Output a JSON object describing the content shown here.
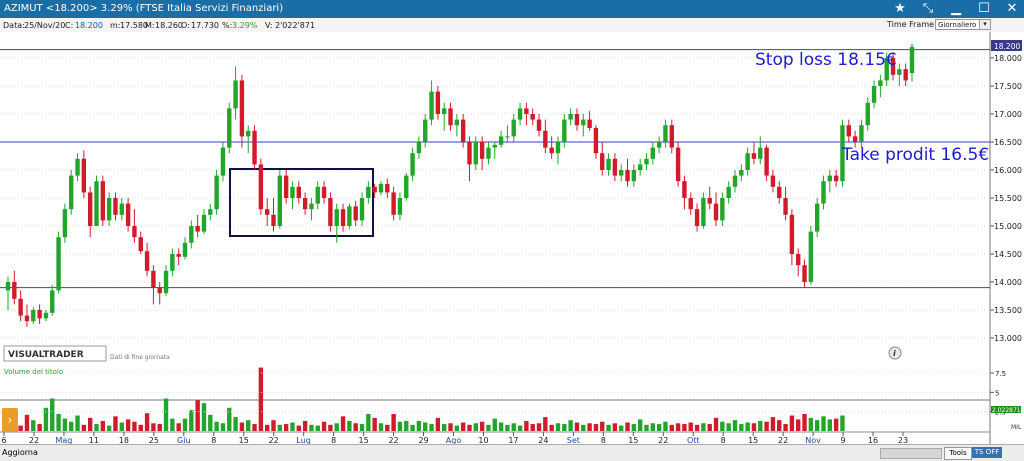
{
  "window": {
    "title": "AZIMUT <18.200> 3.29%  (FTSE Italia Servizi Finanziari)",
    "controls": [
      "star-icon",
      "fullscreen-icon",
      "minimize-icon",
      "maximize-icon",
      "close-icon"
    ]
  },
  "info": {
    "data_label": "Data:",
    "data_value": "25/Nov/20",
    "c_label": "C:",
    "c_value": "18.200",
    "m_label": "m:",
    "m_value": "17.580",
    "M_label": "M:",
    "M_value": "18.260",
    "o_label": "O:",
    "o_value": "17.730",
    "pct_label": "%:",
    "pct_value": "3.29%",
    "v_label": "V:",
    "v_value": "2'022'871",
    "timeframe_label": "Time Frame",
    "timeframe_value": "Giornaliero"
  },
  "chart": {
    "price_axis": [
      "18.000",
      "17.500",
      "17.000",
      "16.500",
      "16.000",
      "15.500",
      "15.000",
      "14.500",
      "14.000",
      "13.500",
      "13.000"
    ],
    "last_price_badge": "18.200",
    "annotations": {
      "stop_loss": "Stop loss 18.15€",
      "take_profit": "Take prodit 16.5€"
    },
    "brand": "VISUALTRADER",
    "brand_sub": "Dati di fine giornata",
    "volume_label": "Volume del titolo",
    "volume_axis": [
      "7.5",
      "5",
      "2.5"
    ],
    "volume_unit": "MIL",
    "volume_last": "2.022871",
    "x_axis": [
      {
        "t": "6",
        "month": false
      },
      {
        "t": "22",
        "month": false
      },
      {
        "t": "Mag",
        "month": true
      },
      {
        "t": "11",
        "month": false
      },
      {
        "t": "18",
        "month": false
      },
      {
        "t": "25",
        "month": false
      },
      {
        "t": "Giu",
        "month": true
      },
      {
        "t": "8",
        "month": false
      },
      {
        "t": "15",
        "month": false
      },
      {
        "t": "22",
        "month": false
      },
      {
        "t": "Lug",
        "month": true
      },
      {
        "t": "8",
        "month": false
      },
      {
        "t": "15",
        "month": false
      },
      {
        "t": "22",
        "month": false
      },
      {
        "t": "29",
        "month": false
      },
      {
        "t": "Ago",
        "month": true
      },
      {
        "t": "10",
        "month": false
      },
      {
        "t": "17",
        "month": false
      },
      {
        "t": "24",
        "month": false
      },
      {
        "t": "Set",
        "month": true
      },
      {
        "t": "8",
        "month": false
      },
      {
        "t": "15",
        "month": false
      },
      {
        "t": "22",
        "month": false
      },
      {
        "t": "Ott",
        "month": true
      },
      {
        "t": "8",
        "month": false
      },
      {
        "t": "15",
        "month": false
      },
      {
        "t": "22",
        "month": false
      },
      {
        "t": "Nov",
        "month": true
      },
      {
        "t": "9",
        "month": false
      },
      {
        "t": "16",
        "month": false
      },
      {
        "t": "23",
        "month": false
      }
    ],
    "info_icon": "info-icon",
    "colors": {
      "up": "#22a52b",
      "down": "#d11a2a",
      "hline": "#3a3ad6",
      "annotation": "#1c1ccf",
      "box": "#111144"
    }
  },
  "bottom": {
    "aggiorna": "Aggiorna",
    "tools": "Tools",
    "ts_off": "TS OFF"
  },
  "chart_data": {
    "type": "candlestick",
    "ylim": [
      12.9,
      18.4
    ],
    "hlines": [
      18.15,
      16.5,
      13.9
    ],
    "series": [
      {
        "o": 13.85,
        "h": 14.1,
        "l": 13.5,
        "c": 14.0
      },
      {
        "o": 14.0,
        "h": 14.2,
        "l": 13.6,
        "c": 13.7
      },
      {
        "o": 13.7,
        "h": 13.85,
        "l": 13.3,
        "c": 13.4
      },
      {
        "o": 13.4,
        "h": 13.6,
        "l": 13.2,
        "c": 13.3
      },
      {
        "o": 13.3,
        "h": 13.55,
        "l": 13.25,
        "c": 13.5
      },
      {
        "o": 13.5,
        "h": 13.6,
        "l": 13.25,
        "c": 13.35
      },
      {
        "o": 13.35,
        "h": 13.5,
        "l": 13.3,
        "c": 13.45
      },
      {
        "o": 13.45,
        "h": 13.95,
        "l": 13.4,
        "c": 13.85
      },
      {
        "o": 13.85,
        "h": 14.9,
        "l": 13.8,
        "c": 14.8
      },
      {
        "o": 14.8,
        "h": 15.4,
        "l": 14.7,
        "c": 15.3
      },
      {
        "o": 15.3,
        "h": 16.0,
        "l": 15.2,
        "c": 15.9
      },
      {
        "o": 15.9,
        "h": 16.3,
        "l": 15.8,
        "c": 16.2
      },
      {
        "o": 16.2,
        "h": 16.35,
        "l": 15.5,
        "c": 15.6
      },
      {
        "o": 15.6,
        "h": 15.7,
        "l": 14.8,
        "c": 15.0
      },
      {
        "o": 15.0,
        "h": 15.9,
        "l": 15.0,
        "c": 15.8
      },
      {
        "o": 15.8,
        "h": 15.9,
        "l": 15.0,
        "c": 15.1
      },
      {
        "o": 15.1,
        "h": 15.6,
        "l": 15.0,
        "c": 15.5
      },
      {
        "o": 15.5,
        "h": 15.6,
        "l": 15.1,
        "c": 15.2
      },
      {
        "o": 15.2,
        "h": 15.5,
        "l": 15.1,
        "c": 15.4
      },
      {
        "o": 15.4,
        "h": 15.5,
        "l": 14.9,
        "c": 15.0
      },
      {
        "o": 15.0,
        "h": 15.3,
        "l": 14.7,
        "c": 14.8
      },
      {
        "o": 14.8,
        "h": 14.9,
        "l": 14.5,
        "c": 14.55
      },
      {
        "o": 14.55,
        "h": 14.7,
        "l": 14.1,
        "c": 14.2
      },
      {
        "o": 14.2,
        "h": 14.3,
        "l": 13.6,
        "c": 13.9
      },
      {
        "o": 13.9,
        "h": 14.0,
        "l": 13.6,
        "c": 13.8
      },
      {
        "o": 13.8,
        "h": 14.3,
        "l": 13.75,
        "c": 14.2
      },
      {
        "o": 14.2,
        "h": 14.6,
        "l": 14.1,
        "c": 14.5
      },
      {
        "o": 14.5,
        "h": 14.6,
        "l": 14.3,
        "c": 14.45
      },
      {
        "o": 14.45,
        "h": 14.8,
        "l": 14.4,
        "c": 14.7
      },
      {
        "o": 14.7,
        "h": 15.1,
        "l": 14.6,
        "c": 15.0
      },
      {
        "o": 15.0,
        "h": 15.2,
        "l": 14.8,
        "c": 14.9
      },
      {
        "o": 14.9,
        "h": 15.3,
        "l": 14.85,
        "c": 15.2
      },
      {
        "o": 15.2,
        "h": 15.4,
        "l": 15.1,
        "c": 15.3
      },
      {
        "o": 15.3,
        "h": 16.0,
        "l": 15.2,
        "c": 15.9
      },
      {
        "o": 15.9,
        "h": 16.5,
        "l": 15.8,
        "c": 16.4
      },
      {
        "o": 16.4,
        "h": 17.2,
        "l": 16.3,
        "c": 17.1
      },
      {
        "o": 17.1,
        "h": 17.85,
        "l": 16.9,
        "c": 17.6
      },
      {
        "o": 17.6,
        "h": 17.7,
        "l": 16.4,
        "c": 16.6
      },
      {
        "o": 16.6,
        "h": 16.8,
        "l": 16.3,
        "c": 16.7
      },
      {
        "o": 16.7,
        "h": 16.8,
        "l": 16.0,
        "c": 16.1
      },
      {
        "o": 16.1,
        "h": 16.2,
        "l": 15.2,
        "c": 15.3
      },
      {
        "o": 15.3,
        "h": 15.5,
        "l": 15.0,
        "c": 15.2
      },
      {
        "o": 15.2,
        "h": 15.5,
        "l": 14.9,
        "c": 15.0
      },
      {
        "o": 15.0,
        "h": 16.0,
        "l": 14.95,
        "c": 15.9
      },
      {
        "o": 15.9,
        "h": 16.0,
        "l": 15.4,
        "c": 15.5
      },
      {
        "o": 15.5,
        "h": 15.8,
        "l": 15.3,
        "c": 15.7
      },
      {
        "o": 15.7,
        "h": 15.8,
        "l": 15.4,
        "c": 15.5
      },
      {
        "o": 15.5,
        "h": 15.6,
        "l": 15.2,
        "c": 15.3
      },
      {
        "o": 15.3,
        "h": 15.5,
        "l": 15.1,
        "c": 15.4
      },
      {
        "o": 15.4,
        "h": 15.8,
        "l": 15.3,
        "c": 15.7
      },
      {
        "o": 15.7,
        "h": 15.8,
        "l": 15.4,
        "c": 15.5
      },
      {
        "o": 15.5,
        "h": 15.6,
        "l": 14.9,
        "c": 15.0
      },
      {
        "o": 15.0,
        "h": 15.4,
        "l": 14.7,
        "c": 15.3
      },
      {
        "o": 15.3,
        "h": 15.4,
        "l": 14.9,
        "c": 15.0
      },
      {
        "o": 15.0,
        "h": 15.4,
        "l": 14.95,
        "c": 15.35
      },
      {
        "o": 15.35,
        "h": 15.45,
        "l": 15.0,
        "c": 15.1
      },
      {
        "o": 15.1,
        "h": 15.6,
        "l": 15.0,
        "c": 15.5
      },
      {
        "o": 15.5,
        "h": 15.8,
        "l": 15.4,
        "c": 15.7
      },
      {
        "o": 15.7,
        "h": 15.75,
        "l": 15.5,
        "c": 15.6
      },
      {
        "o": 15.6,
        "h": 15.8,
        "l": 15.55,
        "c": 15.75
      },
      {
        "o": 15.75,
        "h": 15.85,
        "l": 15.5,
        "c": 15.6
      },
      {
        "o": 15.6,
        "h": 15.7,
        "l": 15.1,
        "c": 15.2
      },
      {
        "o": 15.2,
        "h": 15.6,
        "l": 15.1,
        "c": 15.5
      },
      {
        "o": 15.5,
        "h": 15.95,
        "l": 15.45,
        "c": 15.9
      },
      {
        "o": 15.9,
        "h": 16.4,
        "l": 15.8,
        "c": 16.3
      },
      {
        "o": 16.3,
        "h": 16.6,
        "l": 16.2,
        "c": 16.5
      },
      {
        "o": 16.5,
        "h": 17.0,
        "l": 16.4,
        "c": 16.9
      },
      {
        "o": 16.9,
        "h": 17.6,
        "l": 16.8,
        "c": 17.4
      },
      {
        "o": 17.4,
        "h": 17.5,
        "l": 16.9,
        "c": 17.0
      },
      {
        "o": 17.0,
        "h": 17.2,
        "l": 16.7,
        "c": 17.1
      },
      {
        "o": 17.1,
        "h": 17.2,
        "l": 16.7,
        "c": 16.8
      },
      {
        "o": 16.8,
        "h": 17.0,
        "l": 16.6,
        "c": 16.9
      },
      {
        "o": 16.9,
        "h": 17.0,
        "l": 16.4,
        "c": 16.5
      },
      {
        "o": 16.5,
        "h": 16.6,
        "l": 15.8,
        "c": 16.1
      },
      {
        "o": 16.1,
        "h": 16.6,
        "l": 16.0,
        "c": 16.5
      },
      {
        "o": 16.5,
        "h": 16.6,
        "l": 16.0,
        "c": 16.2
      },
      {
        "o": 16.2,
        "h": 16.5,
        "l": 16.1,
        "c": 16.4
      },
      {
        "o": 16.4,
        "h": 16.5,
        "l": 16.2,
        "c": 16.45
      },
      {
        "o": 16.45,
        "h": 16.7,
        "l": 16.4,
        "c": 16.6
      },
      {
        "o": 16.6,
        "h": 16.8,
        "l": 16.5,
        "c": 16.6
      },
      {
        "o": 16.6,
        "h": 17.0,
        "l": 16.5,
        "c": 16.9
      },
      {
        "o": 16.9,
        "h": 17.2,
        "l": 16.8,
        "c": 17.1
      },
      {
        "o": 17.1,
        "h": 17.2,
        "l": 16.8,
        "c": 17.0
      },
      {
        "o": 17.0,
        "h": 17.1,
        "l": 16.8,
        "c": 16.9
      },
      {
        "o": 16.9,
        "h": 17.0,
        "l": 16.6,
        "c": 16.7
      },
      {
        "o": 16.7,
        "h": 16.9,
        "l": 16.3,
        "c": 16.4
      },
      {
        "o": 16.4,
        "h": 16.6,
        "l": 16.2,
        "c": 16.3
      },
      {
        "o": 16.3,
        "h": 16.6,
        "l": 16.1,
        "c": 16.5
      },
      {
        "o": 16.5,
        "h": 17.0,
        "l": 16.4,
        "c": 16.9
      },
      {
        "o": 16.9,
        "h": 17.1,
        "l": 16.8,
        "c": 17.0
      },
      {
        "o": 17.0,
        "h": 17.1,
        "l": 16.7,
        "c": 16.8
      },
      {
        "o": 16.8,
        "h": 17.0,
        "l": 16.6,
        "c": 16.9
      },
      {
        "o": 16.9,
        "h": 17.05,
        "l": 16.7,
        "c": 16.75
      },
      {
        "o": 16.75,
        "h": 16.8,
        "l": 16.2,
        "c": 16.3
      },
      {
        "o": 16.3,
        "h": 16.5,
        "l": 15.9,
        "c": 16.0
      },
      {
        "o": 16.0,
        "h": 16.3,
        "l": 15.9,
        "c": 16.2
      },
      {
        "o": 16.2,
        "h": 16.3,
        "l": 15.8,
        "c": 15.9
      },
      {
        "o": 15.9,
        "h": 16.1,
        "l": 15.8,
        "c": 16.0
      },
      {
        "o": 16.0,
        "h": 16.2,
        "l": 15.7,
        "c": 15.8
      },
      {
        "o": 15.8,
        "h": 16.1,
        "l": 15.7,
        "c": 16.0
      },
      {
        "o": 16.0,
        "h": 16.2,
        "l": 15.9,
        "c": 16.1
      },
      {
        "o": 16.1,
        "h": 16.3,
        "l": 16.0,
        "c": 16.2
      },
      {
        "o": 16.2,
        "h": 16.5,
        "l": 16.1,
        "c": 16.4
      },
      {
        "o": 16.4,
        "h": 16.6,
        "l": 16.3,
        "c": 16.5
      },
      {
        "o": 16.5,
        "h": 16.9,
        "l": 16.4,
        "c": 16.8
      },
      {
        "o": 16.8,
        "h": 16.9,
        "l": 16.3,
        "c": 16.4
      },
      {
        "o": 16.4,
        "h": 16.5,
        "l": 15.7,
        "c": 15.8
      },
      {
        "o": 15.8,
        "h": 15.9,
        "l": 15.3,
        "c": 15.5
      },
      {
        "o": 15.5,
        "h": 15.6,
        "l": 15.2,
        "c": 15.3
      },
      {
        "o": 15.3,
        "h": 15.4,
        "l": 14.9,
        "c": 15.0
      },
      {
        "o": 15.0,
        "h": 15.6,
        "l": 14.95,
        "c": 15.5
      },
      {
        "o": 15.5,
        "h": 15.7,
        "l": 15.3,
        "c": 15.4
      },
      {
        "o": 15.4,
        "h": 15.6,
        "l": 15.0,
        "c": 15.1
      },
      {
        "o": 15.1,
        "h": 15.6,
        "l": 15.0,
        "c": 15.5
      },
      {
        "o": 15.5,
        "h": 15.8,
        "l": 15.4,
        "c": 15.7
      },
      {
        "o": 15.7,
        "h": 16.0,
        "l": 15.6,
        "c": 15.9
      },
      {
        "o": 15.9,
        "h": 16.1,
        "l": 15.8,
        "c": 16.0
      },
      {
        "o": 16.0,
        "h": 16.4,
        "l": 15.9,
        "c": 16.3
      },
      {
        "o": 16.3,
        "h": 16.5,
        "l": 16.1,
        "c": 16.2
      },
      {
        "o": 16.2,
        "h": 16.6,
        "l": 16.1,
        "c": 16.4
      },
      {
        "o": 16.4,
        "h": 16.45,
        "l": 15.8,
        "c": 15.9
      },
      {
        "o": 15.9,
        "h": 16.0,
        "l": 15.6,
        "c": 15.7
      },
      {
        "o": 15.7,
        "h": 15.8,
        "l": 15.4,
        "c": 15.5
      },
      {
        "o": 15.5,
        "h": 15.7,
        "l": 15.1,
        "c": 15.2
      },
      {
        "o": 15.2,
        "h": 15.3,
        "l": 14.3,
        "c": 14.5
      },
      {
        "o": 14.5,
        "h": 14.6,
        "l": 14.1,
        "c": 14.3
      },
      {
        "o": 14.3,
        "h": 14.4,
        "l": 13.9,
        "c": 14.0
      },
      {
        "o": 14.0,
        "h": 15.0,
        "l": 13.95,
        "c": 14.9
      },
      {
        "o": 14.9,
        "h": 15.5,
        "l": 14.8,
        "c": 15.4
      },
      {
        "o": 15.4,
        "h": 15.9,
        "l": 15.3,
        "c": 15.8
      },
      {
        "o": 15.8,
        "h": 16.0,
        "l": 15.6,
        "c": 15.9
      },
      {
        "o": 15.9,
        "h": 16.0,
        "l": 15.7,
        "c": 15.8
      },
      {
        "o": 15.8,
        "h": 16.9,
        "l": 15.7,
        "c": 16.8
      },
      {
        "o": 16.8,
        "h": 16.9,
        "l": 16.5,
        "c": 16.6
      },
      {
        "o": 16.6,
        "h": 16.7,
        "l": 16.4,
        "c": 16.5
      },
      {
        "o": 16.5,
        "h": 16.9,
        "l": 16.4,
        "c": 16.8
      },
      {
        "o": 16.8,
        "h": 17.3,
        "l": 16.7,
        "c": 17.2
      },
      {
        "o": 17.2,
        "h": 17.6,
        "l": 17.1,
        "c": 17.5
      },
      {
        "o": 17.5,
        "h": 17.7,
        "l": 17.3,
        "c": 17.6
      },
      {
        "o": 17.6,
        "h": 18.1,
        "l": 17.5,
        "c": 18.0
      },
      {
        "o": 18.0,
        "h": 18.1,
        "l": 17.6,
        "c": 17.7
      },
      {
        "o": 17.7,
        "h": 17.9,
        "l": 17.5,
        "c": 17.8
      },
      {
        "o": 17.8,
        "h": 17.9,
        "l": 17.5,
        "c": 17.6
      },
      {
        "o": 17.73,
        "h": 18.26,
        "l": 17.58,
        "c": 18.2
      }
    ],
    "volume": [
      0.9,
      1.1,
      0.7,
      2.1,
      1.4,
      0.9,
      3.0,
      4.2,
      2.2,
      1.6,
      1.2,
      2.0,
      0.8,
      1.7,
      0.9,
      1.3,
      0.7,
      1.9,
      1.1,
      1.5,
      1.2,
      0.8,
      2.3,
      1.0,
      0.9,
      4.2,
      1.6,
      1.0,
      1.6,
      2.7,
      4.0,
      3.6,
      2.1,
      1.2,
      1.0,
      3.0,
      1.8,
      1.1,
      1.4,
      0.9,
      8.2,
      0.8,
      1.4,
      0.8,
      0.9,
      1.1,
      0.7,
      1.3,
      0.8,
      0.7,
      1.2,
      0.8,
      1.0,
      1.9,
      1.3,
      1.0,
      0.9,
      2.2,
      1.7,
      1.0,
      0.8,
      2.2,
      1.2,
      1.3,
      0.8,
      1.3,
      1.1,
      0.9,
      1.7,
      0.9,
      1.0,
      0.7,
      1.1,
      0.8,
      1.0,
      1.2,
      0.8,
      1.6,
      1.1,
      0.8,
      1.0,
      0.7,
      1.3,
      0.9,
      1.0,
      1.8,
      0.8,
      1.0,
      0.9,
      1.4,
      1.1,
      0.8,
      1.0,
      0.9,
      1.2,
      0.8,
      1.0,
      0.7,
      1.1,
      0.9,
      1.5,
      0.8,
      1.0,
      0.9,
      1.2,
      0.8,
      1.0,
      0.9,
      1.1,
      0.8,
      1.0,
      0.9,
      1.7,
      1.2,
      1.0,
      1.4,
      0.9,
      1.1,
      1.0,
      1.3,
      1.2,
      1.8,
      1.4,
      0.9,
      2.0,
      1.5,
      2.2,
      1.7,
      1.4,
      1.9,
      1.5,
      1.6,
      2.0
    ]
  }
}
